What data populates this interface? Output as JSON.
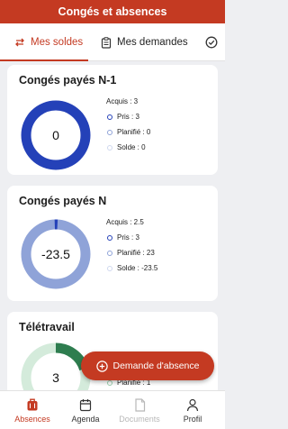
{
  "header": {
    "title": "Congés et absences"
  },
  "tabs": [
    {
      "label": "Mes soldes",
      "icon": "swap-arrows-icon",
      "active": true
    },
    {
      "label": "Mes demandes",
      "icon": "clipboard-icon",
      "active": false
    },
    {
      "label": "",
      "icon": "check-circle-icon",
      "active": false
    }
  ],
  "cards": [
    {
      "title": "Congés payés N-1",
      "center": "0",
      "acquis": "Acquis : 3",
      "pris": "Pris : 3",
      "planifie": "Planifié : 0",
      "solde": "Solde : 0",
      "colors": {
        "pris": "#2441b8",
        "planifie": "#8fa3d8",
        "solde": "#cfd8ef"
      }
    },
    {
      "title": "Congés payés N",
      "center": "-23.5",
      "acquis": "Acquis : 2.5",
      "pris": "Pris : 3",
      "planifie": "Planifié : 23",
      "solde": "Solde : -23.5",
      "colors": {
        "pris": "#2441b8",
        "planifie": "#8fa3d8",
        "solde": "#cfd8ef"
      }
    },
    {
      "title": "Télétravail",
      "center": "3",
      "planifie": "Planifié : 1",
      "colors": {
        "pris": "#2e7d4f",
        "planifie": "#9ccfae",
        "solde": "#d4ebdb"
      }
    }
  ],
  "fab": {
    "label": "Demande d'absence"
  },
  "nav": [
    {
      "label": "Absences",
      "icon": "suitcase-icon",
      "active": true
    },
    {
      "label": "Agenda",
      "icon": "calendar-icon",
      "active": false
    },
    {
      "label": "Documents",
      "icon": "document-icon",
      "active": false,
      "disabled": true
    },
    {
      "label": "Profil",
      "icon": "user-icon",
      "active": false
    }
  ],
  "accent": "#c43a22"
}
